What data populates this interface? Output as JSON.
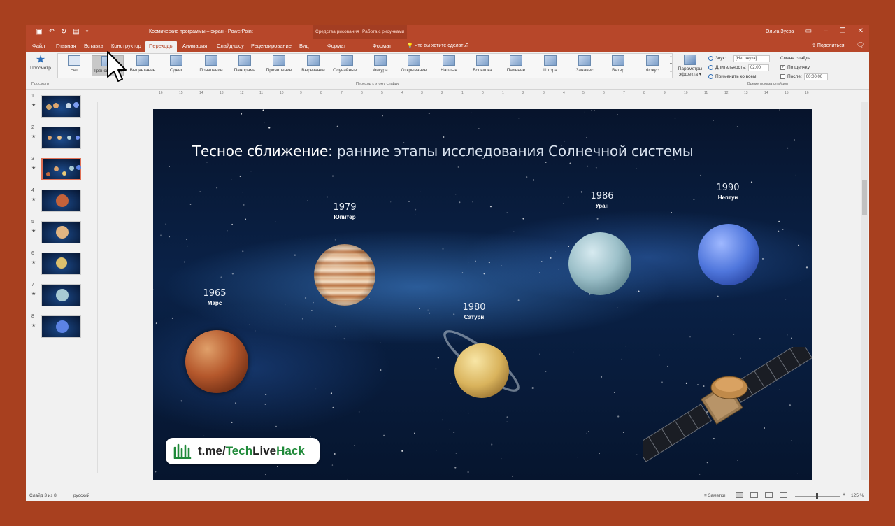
{
  "app": {
    "doc_title": "Космические программы – экран  -  PowerPoint",
    "ctx_drawing": "Средства рисования",
    "ctx_picture": "Работа с рисунками",
    "user": "Ольга Зуева",
    "accent": "#b7472a"
  },
  "tabs": [
    "Файл",
    "Главная",
    "Вставка",
    "Конструктор",
    "Переходы",
    "Анимация",
    "Слайд-шоу",
    "Рецензирование",
    "Вид",
    "Формат",
    "Формат"
  ],
  "active_tab": "Переходы",
  "tell_me": "Что вы хотите сделать?",
  "share": "Поделиться",
  "ribbon": {
    "preview": "Просмотр",
    "preview_group": "Просмотр",
    "transitions": [
      "Нет",
      "Трансформ...",
      "Выцветание",
      "Сдвиг",
      "Появление",
      "Панорама",
      "Проявление",
      "Вырезание",
      "Случайные...",
      "Фигура",
      "Открывание",
      "Наплыв",
      "Вспышка",
      "Падение",
      "Штора",
      "Занавес",
      "Ветер",
      "Фокус"
    ],
    "selected_transition": "Трансформ...",
    "transition_group": "Переход к этому слайду",
    "effect_params": "Параметры эффекта",
    "sound_label": "Звук:",
    "sound_value": "[Нет звука]",
    "duration_label": "Длительность:",
    "duration_value": "02,00",
    "apply_all": "Применить ко всем",
    "advance_label": "Смена слайда",
    "on_click": "По щелчку",
    "after_label": "После:",
    "after_value": "00:00,00",
    "timing_group": "Время показа слайдов"
  },
  "thumbnails": [
    {
      "num": "1",
      "star": "★"
    },
    {
      "num": "2",
      "star": "★"
    },
    {
      "num": "3",
      "star": "★"
    },
    {
      "num": "4",
      "star": "★"
    },
    {
      "num": "5",
      "star": "★"
    },
    {
      "num": "6",
      "star": "★"
    },
    {
      "num": "7",
      "star": "★"
    },
    {
      "num": "8",
      "star": "★"
    }
  ],
  "active_thumbnail": "3",
  "slide": {
    "title_bold": "Тесное сближение:",
    "title_rest": " ранние этапы исследования Солнечной системы",
    "planets": [
      {
        "year": "1965",
        "name": "Марс"
      },
      {
        "year": "1979",
        "name": "Юпитер"
      },
      {
        "year": "1980",
        "name": "Сатурн"
      },
      {
        "year": "1986",
        "name": "Уран"
      },
      {
        "year": "1990",
        "name": "Нептун"
      }
    ],
    "brand_prefix": "t.me/",
    "brand_tech": "Tech",
    "brand_live": "Live",
    "brand_hack": "Hack"
  },
  "ruler_ticks": [
    "16",
    "15",
    "14",
    "13",
    "12",
    "11",
    "10",
    "9",
    "8",
    "7",
    "6",
    "5",
    "4",
    "3",
    "2",
    "1",
    "0",
    "1",
    "2",
    "3",
    "4",
    "5",
    "6",
    "7",
    "8",
    "9",
    "10",
    "11",
    "12",
    "13",
    "14",
    "15",
    "16"
  ],
  "status": {
    "slide_info": "Слайд 3 из 8",
    "language": "русский",
    "notes": "Заметки",
    "zoom": "125 %"
  }
}
